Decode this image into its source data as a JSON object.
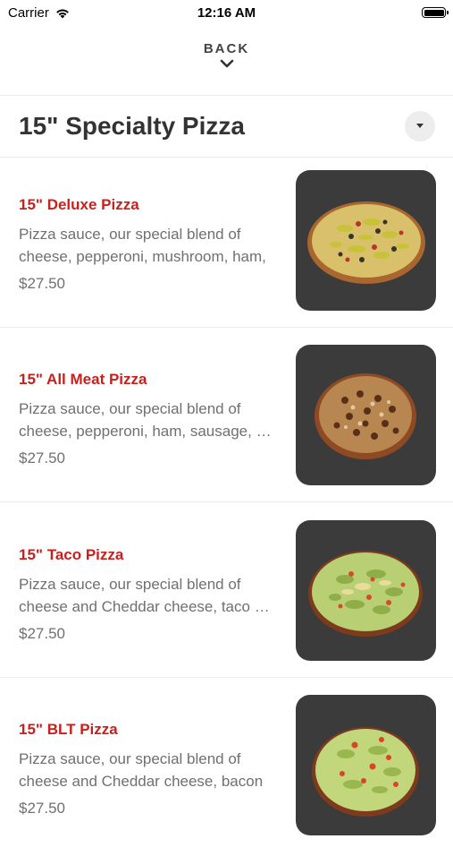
{
  "status_bar": {
    "carrier": "Carrier",
    "time": "12:16 AM"
  },
  "nav": {
    "back_label": "BACK"
  },
  "section": {
    "title": "15\" Specialty Pizza"
  },
  "items": [
    {
      "name": "15\" Deluxe Pizza",
      "desc_line1": "Pizza sauce, our special blend of",
      "desc_line2": "cheese, pepperoni, mushroom, ham,",
      "price": "$27.50",
      "image": "deluxe-pizza-photo"
    },
    {
      "name": "15\" All Meat Pizza",
      "desc_line1": "Pizza sauce, our special blend of",
      "desc_line2": "cheese, pepperoni, ham, sausage, bacon",
      "price": "$27.50",
      "image": "all-meat-pizza-photo"
    },
    {
      "name": "15\" Taco Pizza",
      "desc_line1": "Pizza sauce, our special blend of",
      "desc_line2": "cheese and Cheddar cheese, taco meat",
      "price": "$27.50",
      "image": "taco-pizza-photo"
    },
    {
      "name": "15\" BLT Pizza",
      "desc_line1": "Pizza sauce, our special blend of",
      "desc_line2": "cheese and Cheddar cheese, bacon",
      "price": "$27.50",
      "image": "blt-pizza-photo"
    }
  ],
  "colors": {
    "accent": "#c8201d",
    "text": "#333333",
    "muted": "#707070",
    "photo_bg": "#3b3b3b"
  }
}
